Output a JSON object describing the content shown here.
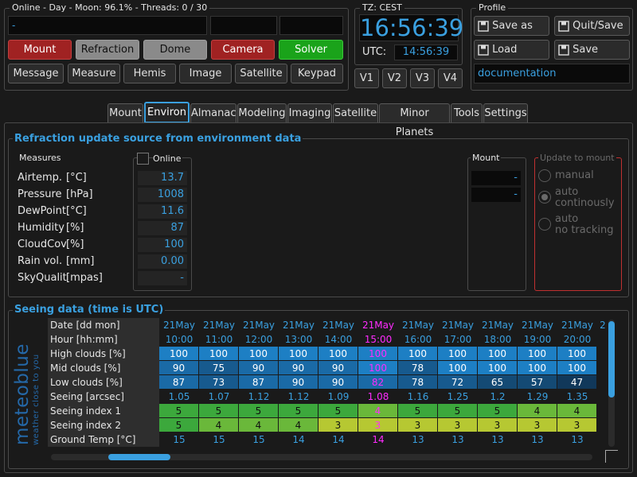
{
  "status": {
    "text": "Online - Day - Moon: 96.1% - Threads: 0 / 30",
    "message": "-"
  },
  "buttons_row1": [
    "Mount",
    "Refraction",
    "Dome",
    "Camera",
    "Solver"
  ],
  "buttons_row2": [
    "Message",
    "Measure",
    "Hemis",
    "Image",
    "Satellite",
    "Keypad"
  ],
  "clock": {
    "tz_label": "TZ: CEST",
    "local_time": "16:56:39",
    "utc_label": "UTC:",
    "utc_time": "14:56:39",
    "versions": [
      "V1",
      "V2",
      "V3",
      "V4"
    ]
  },
  "profile": {
    "title": "Profile",
    "save_as": "Save as",
    "quit_save": "Quit/Save",
    "load": "Load",
    "save": "Save",
    "name": "documentation"
  },
  "tabs": [
    "Mount",
    "Environ",
    "Almanac",
    "Modeling",
    "Imaging",
    "Satellite",
    "Minor Planets",
    "Tools",
    "Settings"
  ],
  "active_tab": "Environ",
  "refraction": {
    "title": "Refraction update source from environment data",
    "measures_title": "Measures",
    "online_label": "Online",
    "rows": [
      {
        "label": "Airtemp.",
        "unit": "[°C]",
        "value": "13.7"
      },
      {
        "label": "Pressure",
        "unit": "[hPa]",
        "value": "1008"
      },
      {
        "label": "DewPoint",
        "unit": "[°C]",
        "value": "11.6"
      },
      {
        "label": "Humidity",
        "unit": "[%]",
        "value": "87"
      },
      {
        "label": "CloudCov",
        "unit": "[%]",
        "value": "100"
      },
      {
        "label": "Rain vol.",
        "unit": "[mm]",
        "value": "0.00"
      },
      {
        "label": "SkyQualit",
        "unit": "[mpas]",
        "value": "-"
      }
    ],
    "mount_title": "Mount",
    "mount_values": [
      "-",
      "-"
    ],
    "update_title": "Update to mount",
    "update_options": [
      {
        "line1": "manual",
        "line2": ""
      },
      {
        "line1": "auto",
        "line2": "continously"
      },
      {
        "line1": "auto",
        "line2": "no tracking"
      }
    ]
  },
  "seeing": {
    "title": "Seeing data (time is UTC)",
    "brand": "meteoblue",
    "brand_tagline": "weather close to you",
    "row_labels": [
      "Date [dd mon]",
      "Hour [hh:mm]",
      "High clouds  [%]",
      "Mid clouds  [%]",
      "Low clouds [%]",
      "Seeing [arcsec]",
      "Seeing index 1",
      "Seeing index 2",
      "Ground Temp [°C]"
    ],
    "dates": [
      "21May",
      "21May",
      "21May",
      "21May",
      "21May",
      "21May",
      "21May",
      "21May",
      "21May",
      "21May",
      "21May",
      "2"
    ],
    "hours": [
      "10:00",
      "11:00",
      "12:00",
      "13:00",
      "14:00",
      "15:00",
      "16:00",
      "17:00",
      "18:00",
      "19:00",
      "20:00",
      ""
    ],
    "high_clouds": [
      "100",
      "100",
      "100",
      "100",
      "100",
      "100",
      "100",
      "100",
      "100",
      "100",
      "100",
      ""
    ],
    "mid_clouds": [
      "90",
      "75",
      "90",
      "90",
      "90",
      "100",
      "78",
      "100",
      "100",
      "100",
      "100",
      ""
    ],
    "low_clouds": [
      "87",
      "73",
      "87",
      "90",
      "90",
      "82",
      "78",
      "72",
      "65",
      "57",
      "47",
      ""
    ],
    "seeing_arcsec": [
      "1.05",
      "1.07",
      "1.12",
      "1.12",
      "1.09",
      "1.08",
      "1.16",
      "1.25",
      "1.2",
      "1.29",
      "1.35",
      ""
    ],
    "index1": [
      "5",
      "5",
      "5",
      "5",
      "5",
      "4",
      "5",
      "5",
      "5",
      "4",
      "4",
      ""
    ],
    "index2": [
      "5",
      "4",
      "4",
      "4",
      "3",
      "3",
      "3",
      "3",
      "3",
      "3",
      "3",
      ""
    ],
    "ground_temp": [
      "15",
      "15",
      "15",
      "14",
      "14",
      "14",
      "13",
      "13",
      "13",
      "13",
      "13",
      ""
    ],
    "highlight_col": 5,
    "colors": {
      "accent": "#3aa0e0",
      "highlight": "#ff2bff",
      "index_green": "#3ca83c",
      "index_yellow": "#b6c832",
      "cloud_blue": "#1e6fb0"
    }
  }
}
